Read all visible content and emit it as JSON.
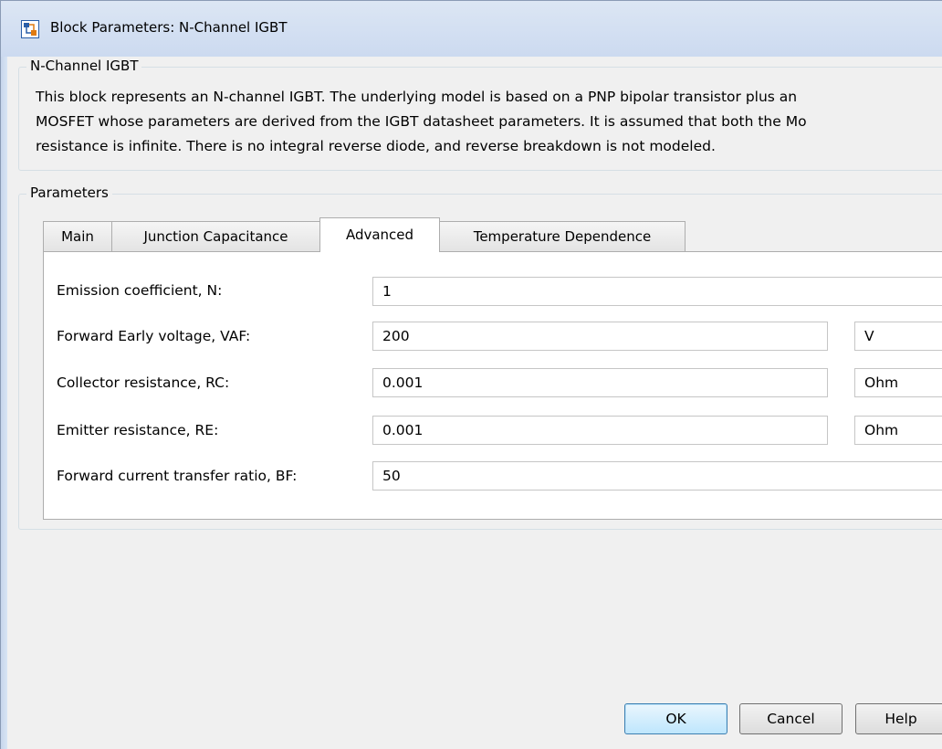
{
  "window": {
    "title": "Block Parameters: N-Channel IGBT"
  },
  "description": {
    "group_label": "N-Channel IGBT",
    "text": "This block represents an N-channel IGBT. The underlying model is based on a PNP bipolar transistor plus an\nMOSFET whose parameters are derived from the IGBT datasheet parameters. It is assumed that both the Mo\nresistance is infinite. There is no integral reverse diode, and reverse breakdown is not modeled."
  },
  "parameters": {
    "group_label": "Parameters",
    "tabs": [
      {
        "label": "Main",
        "active": false
      },
      {
        "label": "Junction Capacitance",
        "active": false
      },
      {
        "label": "Advanced",
        "active": true
      },
      {
        "label": "Temperature Dependence",
        "active": false
      }
    ],
    "rows": [
      {
        "label": "Emission coefficient, N:",
        "value": "1",
        "unit": ""
      },
      {
        "label": "Forward Early voltage, VAF:",
        "value": "200",
        "unit": "V"
      },
      {
        "label": "Collector resistance, RC:",
        "value": "0.001",
        "unit": "Ohm"
      },
      {
        "label": "Emitter resistance, RE:",
        "value": "0.001",
        "unit": "Ohm"
      },
      {
        "label": "Forward current transfer ratio, BF:",
        "value": "50",
        "unit": ""
      }
    ]
  },
  "buttons": {
    "ok": "OK",
    "cancel": "Cancel",
    "help": "Help"
  },
  "icons": {
    "app": "simulink-block-icon"
  },
  "colors": {
    "title_bar": "#d9e4f3",
    "dialog_bg": "#f0f0f0",
    "default_button": "#bee6fd"
  }
}
